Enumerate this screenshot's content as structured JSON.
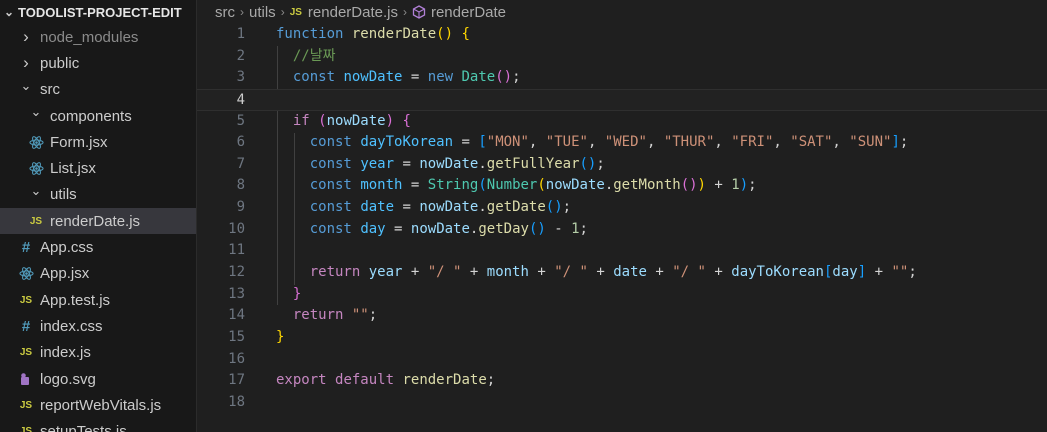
{
  "explorer": {
    "project_title": "TODOLIST-PROJECT-EDIT",
    "items": [
      {
        "label": "node_modules",
        "type": "folder",
        "expanded": false,
        "depth": 0,
        "muted": true
      },
      {
        "label": "public",
        "type": "folder",
        "expanded": false,
        "depth": 0
      },
      {
        "label": "src",
        "type": "folder",
        "expanded": true,
        "depth": 0
      },
      {
        "label": "components",
        "type": "folder",
        "expanded": true,
        "depth": 1
      },
      {
        "label": "Form.jsx",
        "type": "react",
        "depth": 2
      },
      {
        "label": "List.jsx",
        "type": "react",
        "depth": 2
      },
      {
        "label": "utils",
        "type": "folder",
        "expanded": true,
        "depth": 1
      },
      {
        "label": "renderDate.js",
        "type": "js",
        "depth": 2,
        "selected": true
      },
      {
        "label": "App.css",
        "type": "css",
        "depth": 1
      },
      {
        "label": "App.jsx",
        "type": "react",
        "depth": 1
      },
      {
        "label": "App.test.js",
        "type": "js",
        "depth": 1
      },
      {
        "label": "index.css",
        "type": "css",
        "depth": 1
      },
      {
        "label": "index.js",
        "type": "js",
        "depth": 1
      },
      {
        "label": "logo.svg",
        "type": "svg",
        "depth": 1
      },
      {
        "label": "reportWebVitals.js",
        "type": "js",
        "depth": 1
      },
      {
        "label": "setupTests.js",
        "type": "js",
        "depth": 1
      }
    ]
  },
  "breadcrumb": {
    "parts": [
      "src",
      "utils",
      "renderDate.js",
      "renderDate"
    ],
    "file_icon": "JS"
  },
  "editor": {
    "current_line": 4,
    "lines": [
      {
        "n": "1",
        "tokens": [
          [
            "b",
            "function"
          ],
          [
            "p",
            " "
          ],
          [
            "f",
            "renderDate"
          ],
          [
            "br1",
            "()"
          ],
          [
            "p",
            " "
          ],
          [
            "br1",
            "{"
          ]
        ]
      },
      {
        "n": "2",
        "tokens": [
          [
            "p",
            "  "
          ],
          [
            "cm",
            "//날짜"
          ]
        ]
      },
      {
        "n": "3",
        "tokens": [
          [
            "p",
            "  "
          ],
          [
            "b",
            "const"
          ],
          [
            "p",
            " "
          ],
          [
            "c",
            "nowDate"
          ],
          [
            "p",
            " = "
          ],
          [
            "b",
            "new"
          ],
          [
            "p",
            " "
          ],
          [
            "t",
            "Date"
          ],
          [
            "br2",
            "()"
          ],
          [
            "p",
            ";"
          ]
        ]
      },
      {
        "n": "4",
        "tokens": []
      },
      {
        "n": "5",
        "tokens": [
          [
            "p",
            "  "
          ],
          [
            "k",
            "if"
          ],
          [
            "p",
            " "
          ],
          [
            "br2",
            "("
          ],
          [
            "v",
            "nowDate"
          ],
          [
            "br2",
            ")"
          ],
          [
            "p",
            " "
          ],
          [
            "br2",
            "{"
          ]
        ]
      },
      {
        "n": "6",
        "tokens": [
          [
            "p",
            "    "
          ],
          [
            "b",
            "const"
          ],
          [
            "p",
            " "
          ],
          [
            "c",
            "dayToKorean"
          ],
          [
            "p",
            " = "
          ],
          [
            "br3",
            "["
          ],
          [
            "s",
            "\"MON\""
          ],
          [
            "p",
            ", "
          ],
          [
            "s",
            "\"TUE\""
          ],
          [
            "p",
            ", "
          ],
          [
            "s",
            "\"WED\""
          ],
          [
            "p",
            ", "
          ],
          [
            "s",
            "\"THUR\""
          ],
          [
            "p",
            ", "
          ],
          [
            "s",
            "\"FRI\""
          ],
          [
            "p",
            ", "
          ],
          [
            "s",
            "\"SAT\""
          ],
          [
            "p",
            ", "
          ],
          [
            "s",
            "\"SUN\""
          ],
          [
            "br3",
            "]"
          ],
          [
            "p",
            ";"
          ]
        ]
      },
      {
        "n": "7",
        "tokens": [
          [
            "p",
            "    "
          ],
          [
            "b",
            "const"
          ],
          [
            "p",
            " "
          ],
          [
            "c",
            "year"
          ],
          [
            "p",
            " = "
          ],
          [
            "v",
            "nowDate"
          ],
          [
            "p",
            "."
          ],
          [
            "f",
            "getFullYear"
          ],
          [
            "br3",
            "()"
          ],
          [
            "p",
            ";"
          ]
        ]
      },
      {
        "n": "8",
        "tokens": [
          [
            "p",
            "    "
          ],
          [
            "b",
            "const"
          ],
          [
            "p",
            " "
          ],
          [
            "c",
            "month"
          ],
          [
            "p",
            " = "
          ],
          [
            "t",
            "String"
          ],
          [
            "br3",
            "("
          ],
          [
            "t",
            "Number"
          ],
          [
            "br1",
            "("
          ],
          [
            "v",
            "nowDate"
          ],
          [
            "p",
            "."
          ],
          [
            "f",
            "getMonth"
          ],
          [
            "br2",
            "()"
          ],
          [
            "br1",
            ")"
          ],
          [
            "p",
            " + "
          ],
          [
            "n",
            "1"
          ],
          [
            "br3",
            ")"
          ],
          [
            "p",
            ";"
          ]
        ]
      },
      {
        "n": "9",
        "tokens": [
          [
            "p",
            "    "
          ],
          [
            "b",
            "const"
          ],
          [
            "p",
            " "
          ],
          [
            "c",
            "date"
          ],
          [
            "p",
            " = "
          ],
          [
            "v",
            "nowDate"
          ],
          [
            "p",
            "."
          ],
          [
            "f",
            "getDate"
          ],
          [
            "br3",
            "()"
          ],
          [
            "p",
            ";"
          ]
        ]
      },
      {
        "n": "10",
        "tokens": [
          [
            "p",
            "    "
          ],
          [
            "b",
            "const"
          ],
          [
            "p",
            " "
          ],
          [
            "c",
            "day"
          ],
          [
            "p",
            " = "
          ],
          [
            "v",
            "nowDate"
          ],
          [
            "p",
            "."
          ],
          [
            "f",
            "getDay"
          ],
          [
            "br3",
            "()"
          ],
          [
            "p",
            " - "
          ],
          [
            "n",
            "1"
          ],
          [
            "p",
            ";"
          ]
        ]
      },
      {
        "n": "11",
        "tokens": []
      },
      {
        "n": "12",
        "tokens": [
          [
            "p",
            "    "
          ],
          [
            "k",
            "return"
          ],
          [
            "p",
            " "
          ],
          [
            "v",
            "year"
          ],
          [
            "p",
            " + "
          ],
          [
            "s",
            "\"/ \""
          ],
          [
            "p",
            " + "
          ],
          [
            "v",
            "month"
          ],
          [
            "p",
            " + "
          ],
          [
            "s",
            "\"/ \""
          ],
          [
            "p",
            " + "
          ],
          [
            "v",
            "date"
          ],
          [
            "p",
            " + "
          ],
          [
            "s",
            "\"/ \""
          ],
          [
            "p",
            " + "
          ],
          [
            "v",
            "dayToKorean"
          ],
          [
            "br3",
            "["
          ],
          [
            "v",
            "day"
          ],
          [
            "br3",
            "]"
          ],
          [
            "p",
            " + "
          ],
          [
            "s",
            "\"\""
          ],
          [
            "p",
            ";"
          ]
        ]
      },
      {
        "n": "13",
        "tokens": [
          [
            "p",
            "  "
          ],
          [
            "br2",
            "}"
          ]
        ]
      },
      {
        "n": "14",
        "tokens": [
          [
            "p",
            "  "
          ],
          [
            "k",
            "return"
          ],
          [
            "p",
            " "
          ],
          [
            "s",
            "\"\""
          ],
          [
            "p",
            ";"
          ]
        ]
      },
      {
        "n": "15",
        "tokens": [
          [
            "br1",
            "}"
          ]
        ]
      },
      {
        "n": "16",
        "tokens": []
      },
      {
        "n": "17",
        "tokens": [
          [
            "k",
            "export"
          ],
          [
            "p",
            " "
          ],
          [
            "k",
            "default"
          ],
          [
            "p",
            " "
          ],
          [
            "f",
            "renderDate"
          ],
          [
            "p",
            ";"
          ]
        ]
      },
      {
        "n": "18",
        "tokens": []
      }
    ]
  }
}
